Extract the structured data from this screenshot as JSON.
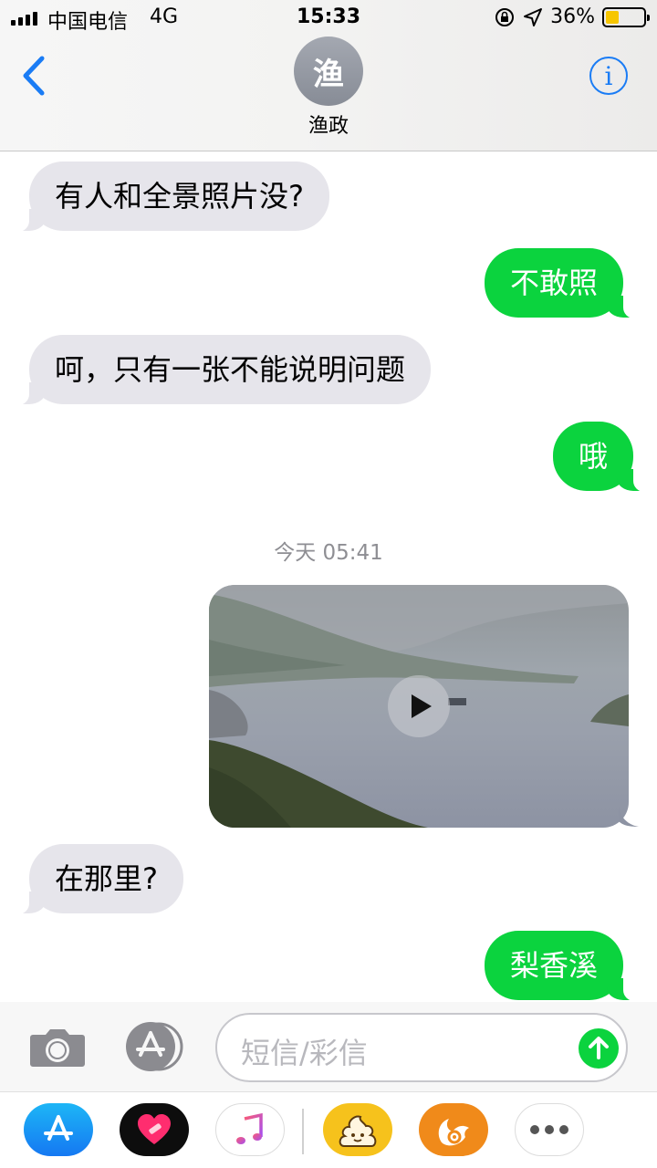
{
  "status": {
    "carrier": "中国电信",
    "network": "4G",
    "time": "15:33",
    "battery": "36%",
    "battery_level": 0.36
  },
  "header": {
    "avatar_initial": "渔",
    "contact_name": "渔政",
    "info_glyph": "i"
  },
  "messages": [
    {
      "direction": "in",
      "text": "有人和全景照片没?"
    },
    {
      "direction": "out",
      "text": "不敢照"
    },
    {
      "direction": "in",
      "text": "呵，只有一张不能说明问题"
    },
    {
      "direction": "out",
      "text": "哦"
    },
    {
      "direction": "out",
      "type": "video"
    },
    {
      "direction": "in",
      "text": "在那里?"
    },
    {
      "direction": "out",
      "text": "梨香溪"
    }
  ],
  "timestamp": "今天 05:41",
  "input": {
    "placeholder": "短信/彩信"
  },
  "apps": [
    {
      "name": "app-store-app-icon"
    },
    {
      "name": "heart-app-icon"
    },
    {
      "name": "music-app-icon"
    },
    {
      "name": "poop-sticker-app-icon"
    },
    {
      "name": "uc-browser-app-icon"
    },
    {
      "name": "more-apps-icon"
    }
  ],
  "colors": {
    "sms_green": "#0bd33e",
    "incoming_gray": "#e6e5eb",
    "ios_blue": "#1a7cf5"
  }
}
